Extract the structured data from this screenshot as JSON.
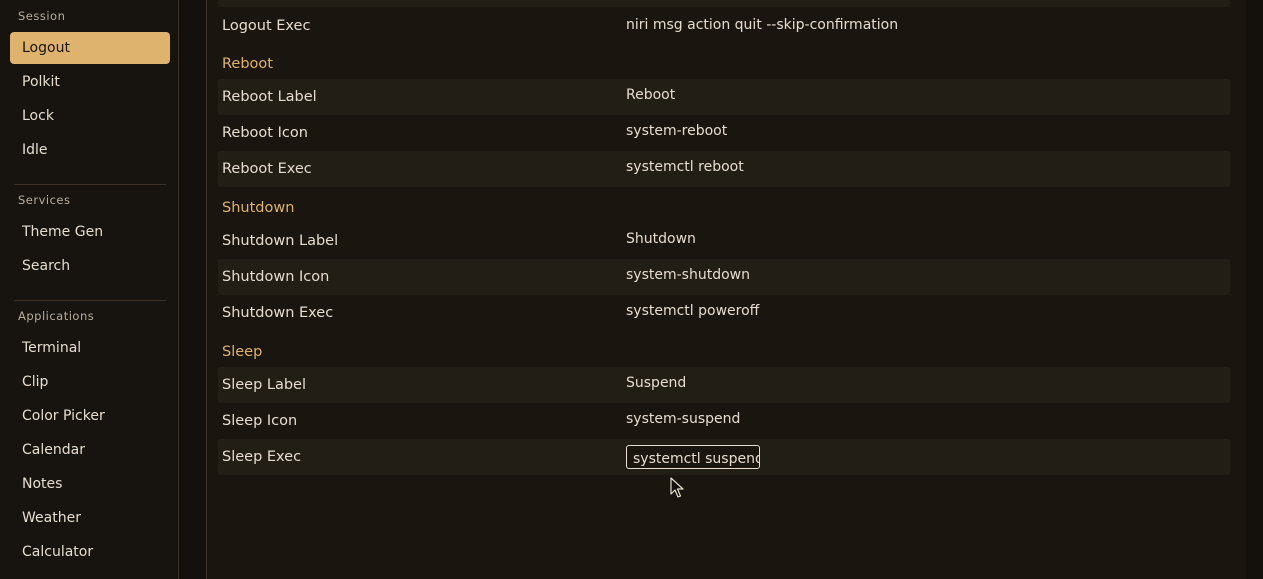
{
  "sidebar": {
    "sections": [
      {
        "title": "Session",
        "items": [
          "Logout",
          "Polkit",
          "Lock",
          "Idle"
        ]
      },
      {
        "title": "Services",
        "items": [
          "Theme Gen",
          "Search"
        ]
      },
      {
        "title": "Applications",
        "items": [
          "Terminal",
          "Clip",
          "Color Picker",
          "Calendar",
          "Notes",
          "Weather",
          "Calculator"
        ]
      }
    ],
    "active_item": "Logout"
  },
  "settings": {
    "logout_exec": {
      "label": "Logout Exec",
      "value": "niri msg action quit --skip-confirmation"
    },
    "reboot": {
      "title": "Reboot",
      "rows": [
        {
          "label": "Reboot Label",
          "value": "Reboot"
        },
        {
          "label": "Reboot Icon",
          "value": "system-reboot"
        },
        {
          "label": "Reboot Exec",
          "value": "systemctl reboot"
        }
      ]
    },
    "shutdown": {
      "title": "Shutdown",
      "rows": [
        {
          "label": "Shutdown Label",
          "value": "Shutdown"
        },
        {
          "label": "Shutdown Icon",
          "value": "system-shutdown"
        },
        {
          "label": "Shutdown Exec",
          "value": "systemctl poweroff"
        }
      ]
    },
    "sleep": {
      "title": "Sleep",
      "rows": [
        {
          "label": "Sleep Label",
          "value": "Suspend"
        },
        {
          "label": "Sleep Icon",
          "value": "system-suspend"
        },
        {
          "label": "Sleep Exec",
          "value": "systemctl suspend"
        }
      ]
    }
  },
  "colors": {
    "accent": "#deb36d",
    "background": "#14100b",
    "panel": "#1a150f",
    "row_alt": "#221d15"
  }
}
